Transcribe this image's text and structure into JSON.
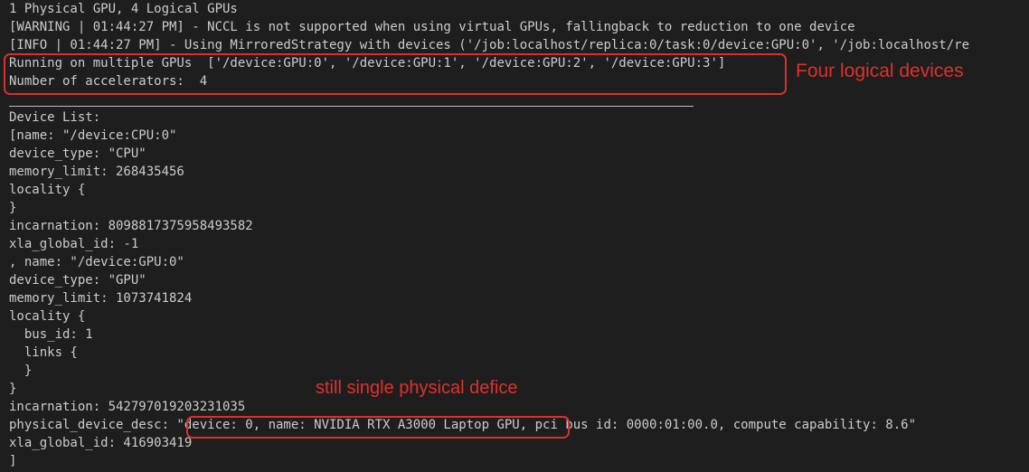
{
  "terminal": {
    "lines": [
      "1 Physical GPU, 4 Logical GPUs",
      "[WARNING | 01:44:27 PM] - NCCL is not supported when using virtual GPUs, fallingback to reduction to one device",
      "[INFO | 01:44:27 PM] - Using MirroredStrategy with devices ('/job:localhost/replica:0/task:0/device:GPU:0', '/job:localhost/re",
      "Running on multiple GPUs  ['/device:GPU:0', '/device:GPU:1', '/device:GPU:2', '/device:GPU:3']",
      "Number of accelerators:  4",
      "",
      "Device List:",
      "[name: \"/device:CPU:0\"",
      "device_type: \"CPU\"",
      "memory_limit: 268435456",
      "locality {",
      "}",
      "incarnation: 8098817375958493582",
      "xla_global_id: -1",
      ", name: \"/device:GPU:0\"",
      "device_type: \"GPU\"",
      "memory_limit: 1073741824",
      "locality {",
      "  bus_id: 1",
      "  links {",
      "  }",
      "}",
      "incarnation: 542797019203231035",
      "physical_device_desc: \"device: 0, name: NVIDIA RTX A3000 Laptop GPU, pci bus id: 0000:01:00.0, compute capability: 8.6\"",
      "xla_global_id: 416903419",
      "]"
    ]
  },
  "annotations": {
    "four_logical_devices": "Four logical devices",
    "still_single_physical": "still single physical defice",
    "color": "#e0302e"
  },
  "theme": {
    "background": "#1e1e1e",
    "text": "#cccccc"
  }
}
